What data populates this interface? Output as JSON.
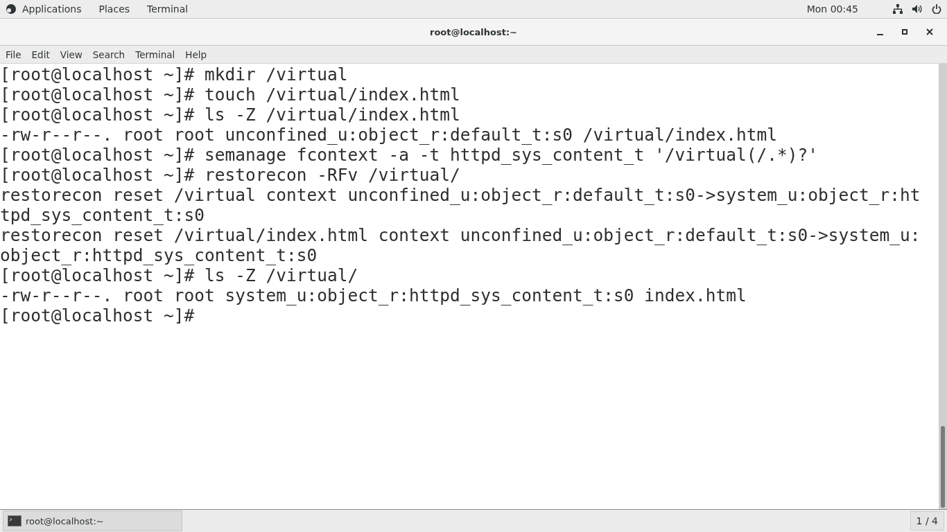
{
  "top_bar": {
    "menus": [
      "Applications",
      "Places",
      "Terminal"
    ],
    "clock": "Mon 00:45"
  },
  "window": {
    "title": "root@localhost:~"
  },
  "menu_bar": [
    "File",
    "Edit",
    "View",
    "Search",
    "Terminal",
    "Help"
  ],
  "terminal_lines": [
    "[root@localhost ~]# mkdir /virtual",
    "[root@localhost ~]# touch /virtual/index.html",
    "[root@localhost ~]# ls -Z /virtual/index.html",
    "-rw-r--r--. root root unconfined_u:object_r:default_t:s0 /virtual/index.html",
    "[root@localhost ~]# semanage fcontext -a -t httpd_sys_content_t '/virtual(/.*)?'",
    "[root@localhost ~]# restorecon -RFv /virtual/",
    "restorecon reset /virtual context unconfined_u:object_r:default_t:s0->system_u:object_r:ht",
    "tpd_sys_content_t:s0",
    "restorecon reset /virtual/index.html context unconfined_u:object_r:default_t:s0->system_u:",
    "object_r:httpd_sys_content_t:s0",
    "[root@localhost ~]# ls -Z /virtual/",
    "-rw-r--r--. root root system_u:object_r:httpd_sys_content_t:s0 index.html",
    "[root@localhost ~]# "
  ],
  "taskbar": {
    "window_button": "root@localhost:~",
    "workspace": "1 / 4"
  }
}
